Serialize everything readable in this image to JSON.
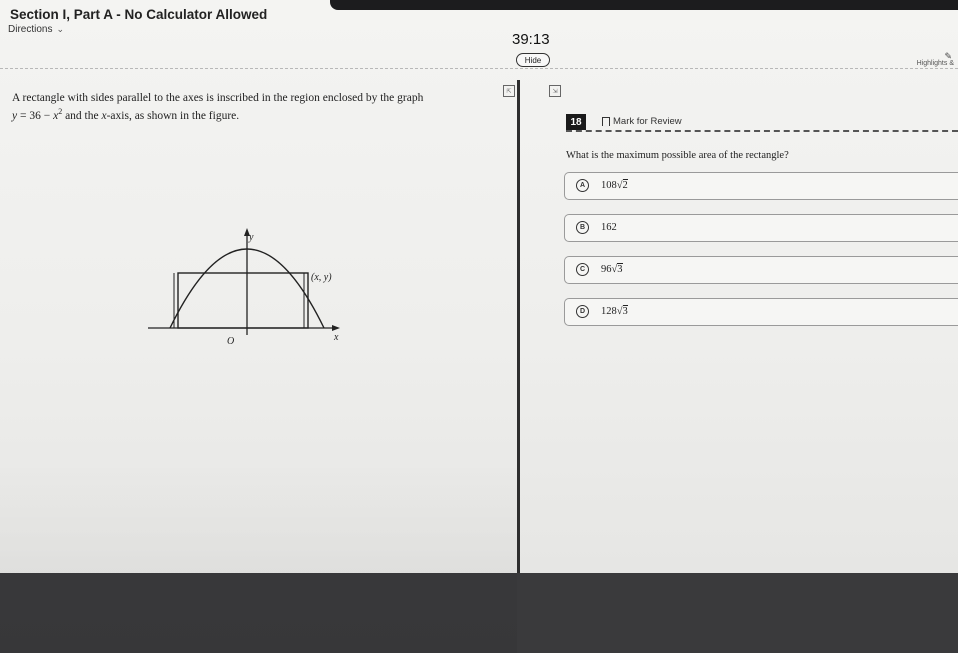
{
  "header": {
    "section_title": "Section I, Part A - No Calculator Allowed",
    "directions_label": "Directions",
    "timer": "39:13",
    "hide_label": "Hide",
    "highlights_label": "Highlights &"
  },
  "prompt": {
    "line1": "A rectangle with sides parallel to the axes is inscribed in the region enclosed by the graph",
    "eq_y": "y",
    "eq_mid": " = 36 − ",
    "eq_x": "x",
    "eq_exp": "2",
    "line2_rest": " and the ",
    "line2_xaxis": "x",
    "line2_end": "-axis, as shown in the figure."
  },
  "figure": {
    "y_label": "y",
    "x_label": "x",
    "origin_label": "O",
    "point_label": "(x, y)"
  },
  "question": {
    "number": "18",
    "mark_label": "Mark for Review",
    "text": "What is the maximum possible area of the rectangle?",
    "choices": [
      {
        "letter": "A",
        "coef": "108",
        "radicand": "2"
      },
      {
        "letter": "B",
        "coef": "162",
        "radicand": ""
      },
      {
        "letter": "C",
        "coef": "96",
        "radicand": "3"
      },
      {
        "letter": "D",
        "coef": "128",
        "radicand": "3"
      }
    ]
  }
}
